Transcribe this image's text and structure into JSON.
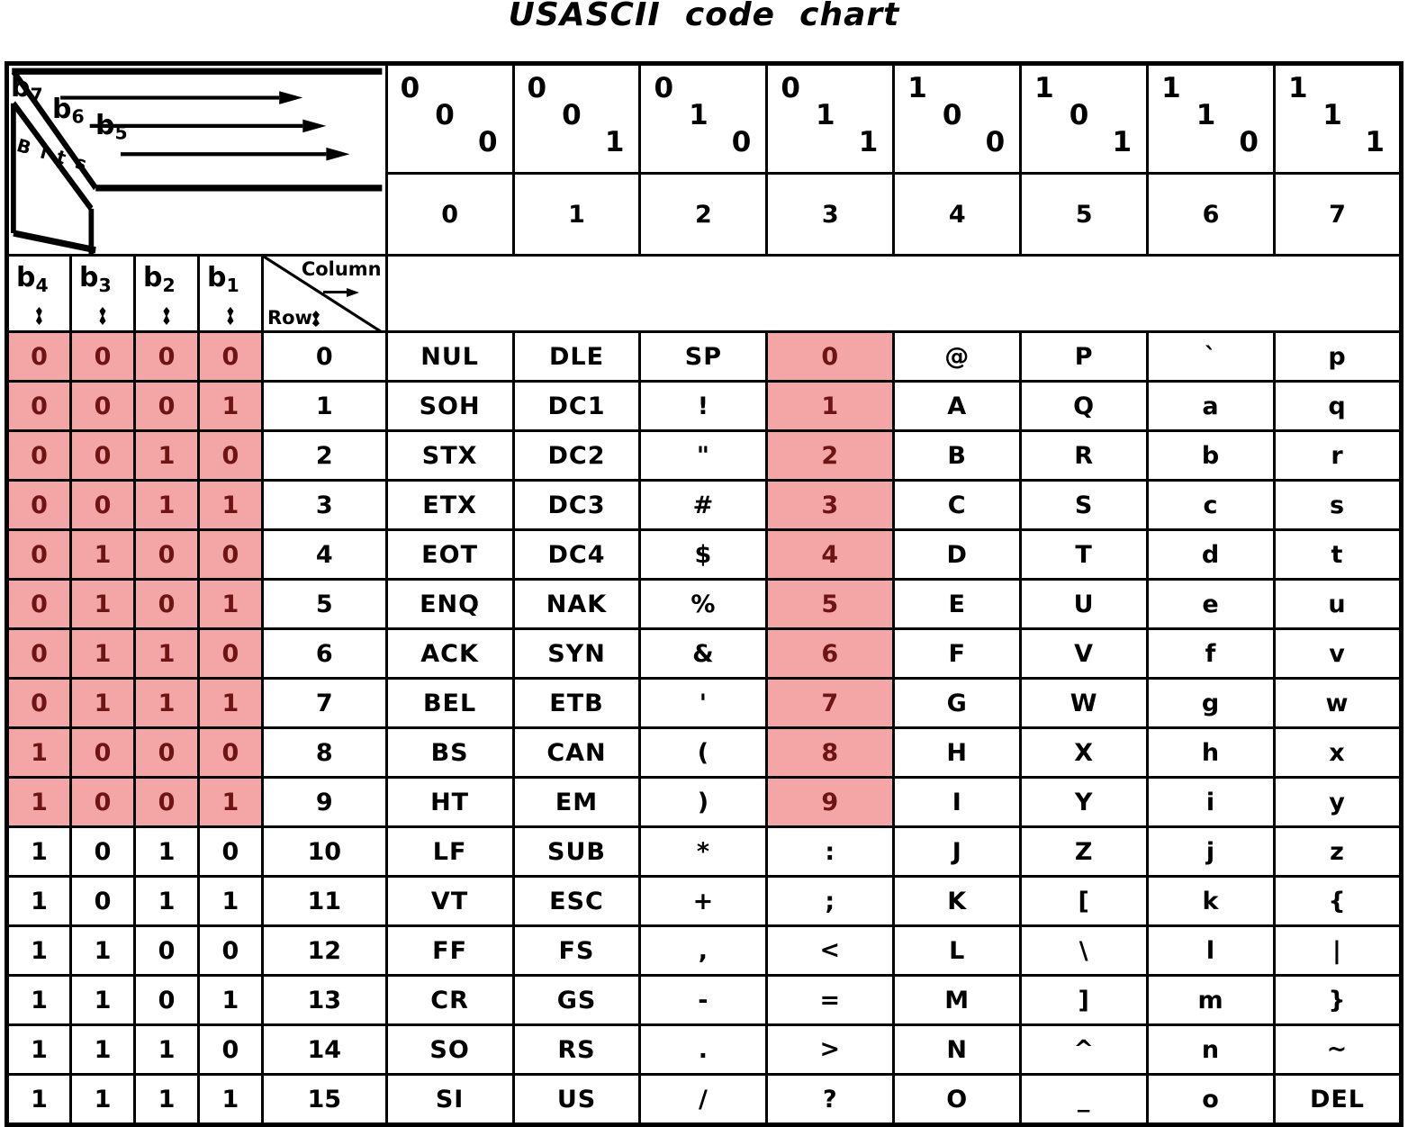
{
  "title": "USASCII  code  chart",
  "colors": {
    "highlight_fill": "#f4a6a6",
    "highlight_text": "#6d1414",
    "highlight_border": "#7d1414",
    "ink": "#000000",
    "paper": "#ffffff"
  },
  "header": {
    "bits_label": "Bits",
    "high_bits": [
      "b7",
      "b6",
      "b5"
    ],
    "low_bits": [
      "b4",
      "b3",
      "b2",
      "b1"
    ],
    "column_label": "Column",
    "row_label": "Row",
    "binary_columns": [
      {
        "bits": [
          "0",
          "0",
          "0"
        ],
        "number": "0"
      },
      {
        "bits": [
          "0",
          "0",
          "1"
        ],
        "number": "1"
      },
      {
        "bits": [
          "0",
          "1",
          "0"
        ],
        "number": "2"
      },
      {
        "bits": [
          "0",
          "1",
          "1"
        ],
        "number": "3"
      },
      {
        "bits": [
          "1",
          "0",
          "0"
        ],
        "number": "4"
      },
      {
        "bits": [
          "1",
          "0",
          "1"
        ],
        "number": "5"
      },
      {
        "bits": [
          "1",
          "1",
          "0"
        ],
        "number": "6"
      },
      {
        "bits": [
          "1",
          "1",
          "1"
        ],
        "number": "7"
      }
    ]
  },
  "rows": [
    {
      "bits": [
        "0",
        "0",
        "0",
        "0"
      ],
      "number": "0",
      "cells": [
        "NUL",
        "DLE",
        "SP",
        "0",
        "@",
        "P",
        "`",
        "p"
      ],
      "bits_highlighted": true,
      "highlight_cols": [
        3
      ]
    },
    {
      "bits": [
        "0",
        "0",
        "0",
        "1"
      ],
      "number": "1",
      "cells": [
        "SOH",
        "DC1",
        "!",
        "1",
        "A",
        "Q",
        "a",
        "q"
      ],
      "bits_highlighted": true,
      "highlight_cols": [
        3
      ]
    },
    {
      "bits": [
        "0",
        "0",
        "1",
        "0"
      ],
      "number": "2",
      "cells": [
        "STX",
        "DC2",
        "\"",
        "2",
        "B",
        "R",
        "b",
        "r"
      ],
      "bits_highlighted": true,
      "highlight_cols": [
        3
      ]
    },
    {
      "bits": [
        "0",
        "0",
        "1",
        "1"
      ],
      "number": "3",
      "cells": [
        "ETX",
        "DC3",
        "#",
        "3",
        "C",
        "S",
        "c",
        "s"
      ],
      "bits_highlighted": true,
      "highlight_cols": [
        3
      ]
    },
    {
      "bits": [
        "0",
        "1",
        "0",
        "0"
      ],
      "number": "4",
      "cells": [
        "EOT",
        "DC4",
        "$",
        "4",
        "D",
        "T",
        "d",
        "t"
      ],
      "bits_highlighted": true,
      "highlight_cols": [
        3
      ]
    },
    {
      "bits": [
        "0",
        "1",
        "0",
        "1"
      ],
      "number": "5",
      "cells": [
        "ENQ",
        "NAK",
        "%",
        "5",
        "E",
        "U",
        "e",
        "u"
      ],
      "bits_highlighted": true,
      "highlight_cols": [
        3
      ]
    },
    {
      "bits": [
        "0",
        "1",
        "1",
        "0"
      ],
      "number": "6",
      "cells": [
        "ACK",
        "SYN",
        "&",
        "6",
        "F",
        "V",
        "f",
        "v"
      ],
      "bits_highlighted": true,
      "highlight_cols": [
        3
      ]
    },
    {
      "bits": [
        "0",
        "1",
        "1",
        "1"
      ],
      "number": "7",
      "cells": [
        "BEL",
        "ETB",
        "'",
        "7",
        "G",
        "W",
        "g",
        "w"
      ],
      "bits_highlighted": true,
      "highlight_cols": [
        3
      ]
    },
    {
      "bits": [
        "1",
        "0",
        "0",
        "0"
      ],
      "number": "8",
      "cells": [
        "BS",
        "CAN",
        "(",
        "8",
        "H",
        "X",
        "h",
        "x"
      ],
      "bits_highlighted": true,
      "highlight_cols": [
        3
      ]
    },
    {
      "bits": [
        "1",
        "0",
        "0",
        "1"
      ],
      "number": "9",
      "cells": [
        "HT",
        "EM",
        ")",
        "9",
        "I",
        "Y",
        "i",
        "y"
      ],
      "bits_highlighted": true,
      "highlight_cols": [
        3
      ]
    },
    {
      "bits": [
        "1",
        "0",
        "1",
        "0"
      ],
      "number": "10",
      "cells": [
        "LF",
        "SUB",
        "*",
        ":",
        "J",
        "Z",
        "j",
        "z"
      ],
      "bits_highlighted": false,
      "highlight_cols": []
    },
    {
      "bits": [
        "1",
        "0",
        "1",
        "1"
      ],
      "number": "11",
      "cells": [
        "VT",
        "ESC",
        "+",
        ";",
        "K",
        "[",
        "k",
        "{"
      ],
      "bits_highlighted": false,
      "highlight_cols": []
    },
    {
      "bits": [
        "1",
        "1",
        "0",
        "0"
      ],
      "number": "12",
      "cells": [
        "FF",
        "FS",
        ",",
        "<",
        "L",
        "\\",
        "l",
        "|"
      ],
      "bits_highlighted": false,
      "highlight_cols": []
    },
    {
      "bits": [
        "1",
        "1",
        "0",
        "1"
      ],
      "number": "13",
      "cells": [
        "CR",
        "GS",
        "-",
        "=",
        "M",
        "]",
        "m",
        "}"
      ],
      "bits_highlighted": false,
      "highlight_cols": []
    },
    {
      "bits": [
        "1",
        "1",
        "1",
        "0"
      ],
      "number": "14",
      "cells": [
        "SO",
        "RS",
        ".",
        ">",
        "N",
        "^",
        "n",
        "~"
      ],
      "bits_highlighted": false,
      "highlight_cols": []
    },
    {
      "bits": [
        "1",
        "1",
        "1",
        "1"
      ],
      "number": "15",
      "cells": [
        "SI",
        "US",
        "/",
        "?",
        "O",
        "_",
        "o",
        "DEL"
      ],
      "bits_highlighted": false,
      "highlight_cols": []
    }
  ]
}
